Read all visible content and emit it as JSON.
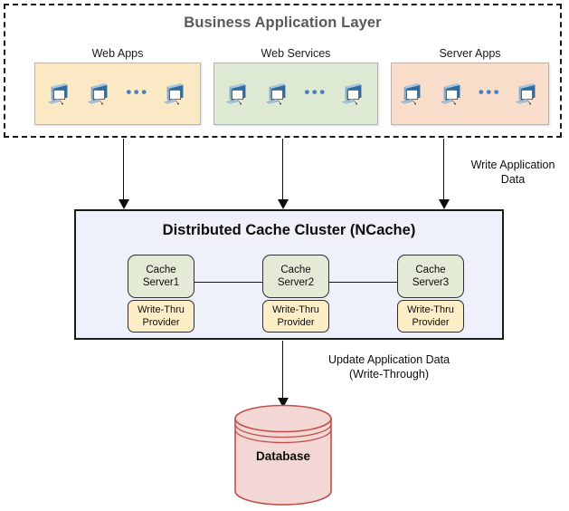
{
  "app_layer": {
    "title": "Business Application Layer",
    "groups": [
      {
        "label": "Web Apps",
        "icon": "computer-icon",
        "ellipsis": "•••"
      },
      {
        "label": "Web Services",
        "icon": "computer-icon",
        "ellipsis": "•••"
      },
      {
        "label": "Server Apps",
        "icon": "computer-icon",
        "ellipsis": "•••"
      }
    ]
  },
  "annotations": {
    "write_application_data": "Write Application\nData",
    "update_application_data": "Update Application Data\n(Write-Through)"
  },
  "cluster": {
    "title": "Distributed Cache Cluster (NCache)",
    "nodes": [
      {
        "server": "Cache\nServer1",
        "provider": "Write-Thru\nProvider"
      },
      {
        "server": "Cache\nServer2",
        "provider": "Write-Thru\nProvider"
      },
      {
        "server": "Cache\nServer3",
        "provider": "Write-Thru\nProvider"
      }
    ]
  },
  "database": {
    "label": "Database"
  },
  "colors": {
    "web_apps_panel": "#fbe9c6",
    "web_services_panel": "#dde9d2",
    "server_apps_panel": "#f9ddcb",
    "cluster_fill": "#eef1fa",
    "cache_server_fill": "#e3ead5",
    "provider_fill": "#fdeec8",
    "database_fill": "#f2d7d5",
    "database_stroke": "#c0504d",
    "title_gray": "#595959",
    "dots_blue": "#4f81bd"
  }
}
